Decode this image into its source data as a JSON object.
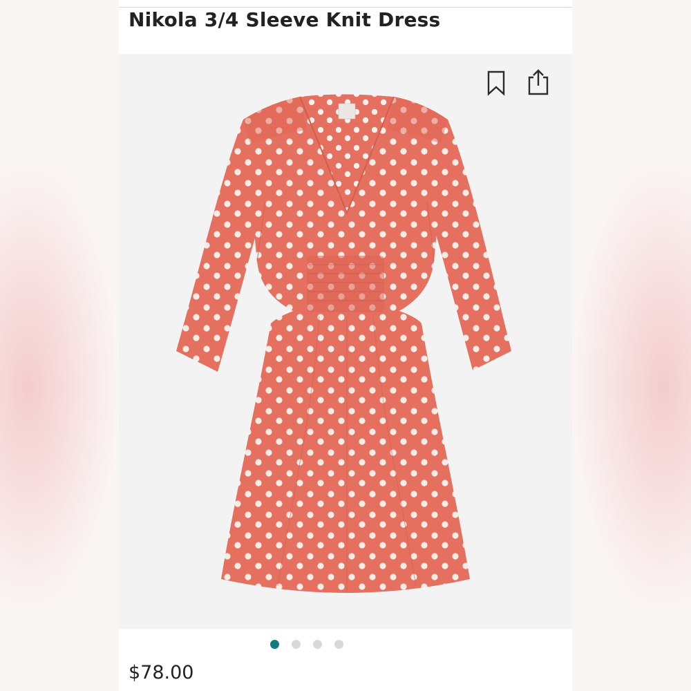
{
  "product": {
    "title": "Nikola 3/4 Sleeve Knit Dress",
    "price": "$78.00"
  },
  "gallery": {
    "image_subject": "coral polka dot knit dress with three-quarter sleeves",
    "slide_count": 4,
    "active_slide": 1
  },
  "icons": {
    "bookmark": "bookmark-icon",
    "share": "share-icon"
  },
  "colors": {
    "dress": "#e5705f",
    "dots": "#f5ece6",
    "active_indicator": "#127a80",
    "inactive_indicator": "#d9d9db",
    "gallery_background": "#f4f3f4"
  }
}
